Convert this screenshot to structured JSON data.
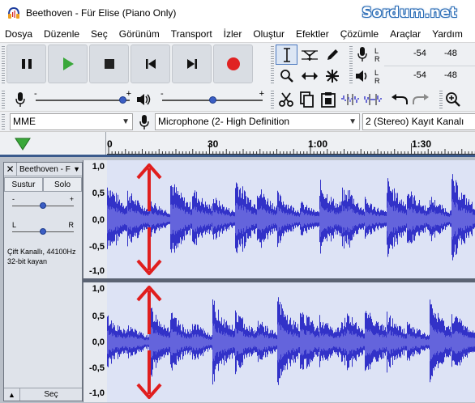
{
  "window": {
    "title": "Beethoven - Für Elise (Piano Only)",
    "watermark": "Sordum.net"
  },
  "menu": [
    "Dosya",
    "Düzenle",
    "Seç",
    "Görünüm",
    "Transport",
    "İzler",
    "Oluştur",
    "Efektler",
    "Çözümle",
    "Araçlar",
    "Yardım"
  ],
  "transport": [
    "pause-icon",
    "play-icon",
    "stop-icon",
    "skip-start-icon",
    "skip-end-icon",
    "record-icon"
  ],
  "tools": [
    "selection-tool-icon",
    "envelope-tool-icon",
    "draw-tool-icon",
    "zoom-tool-icon",
    "timeshift-tool-icon",
    "multi-tool-icon"
  ],
  "meters": {
    "record": {
      "left": "L",
      "right": "R",
      "scale": [
        "-54",
        "-48"
      ]
    },
    "playback": {
      "left": "L",
      "right": "R",
      "scale": [
        "-54",
        "-48"
      ]
    }
  },
  "mixer": {
    "record_level": 0.92,
    "playback_level": 0.5
  },
  "devices": {
    "host": "MME",
    "recording_device": "Microphone (2- High Definition",
    "channels": "2 (Stereo) Kayıt Kanalı"
  },
  "ruler": {
    "start": "0",
    "ticks": [
      "30",
      "1:00",
      "1:30"
    ]
  },
  "track": {
    "name": "Beethoven - F",
    "mute_label": "Sustur",
    "solo_label": "Solo",
    "gain_minus": "-",
    "gain_plus": "+",
    "pan_left": "L",
    "pan_right": "R",
    "info_line1": "Çift Kanallı, 44100Hz",
    "info_line2": "32-bit kayan",
    "select_label": "Seç",
    "gain_level": 0.5,
    "pan_level": 0.5
  },
  "vertical_scale": [
    "1,0",
    "0,5",
    "0,0",
    "-0,5",
    "-1,0"
  ],
  "colors": {
    "waveform": "#3232c8",
    "waveform_rms": "#6464dc",
    "annotation_arrow": "#e01e1e",
    "record_red": "#e02222",
    "play_green": "#3aa83a"
  }
}
